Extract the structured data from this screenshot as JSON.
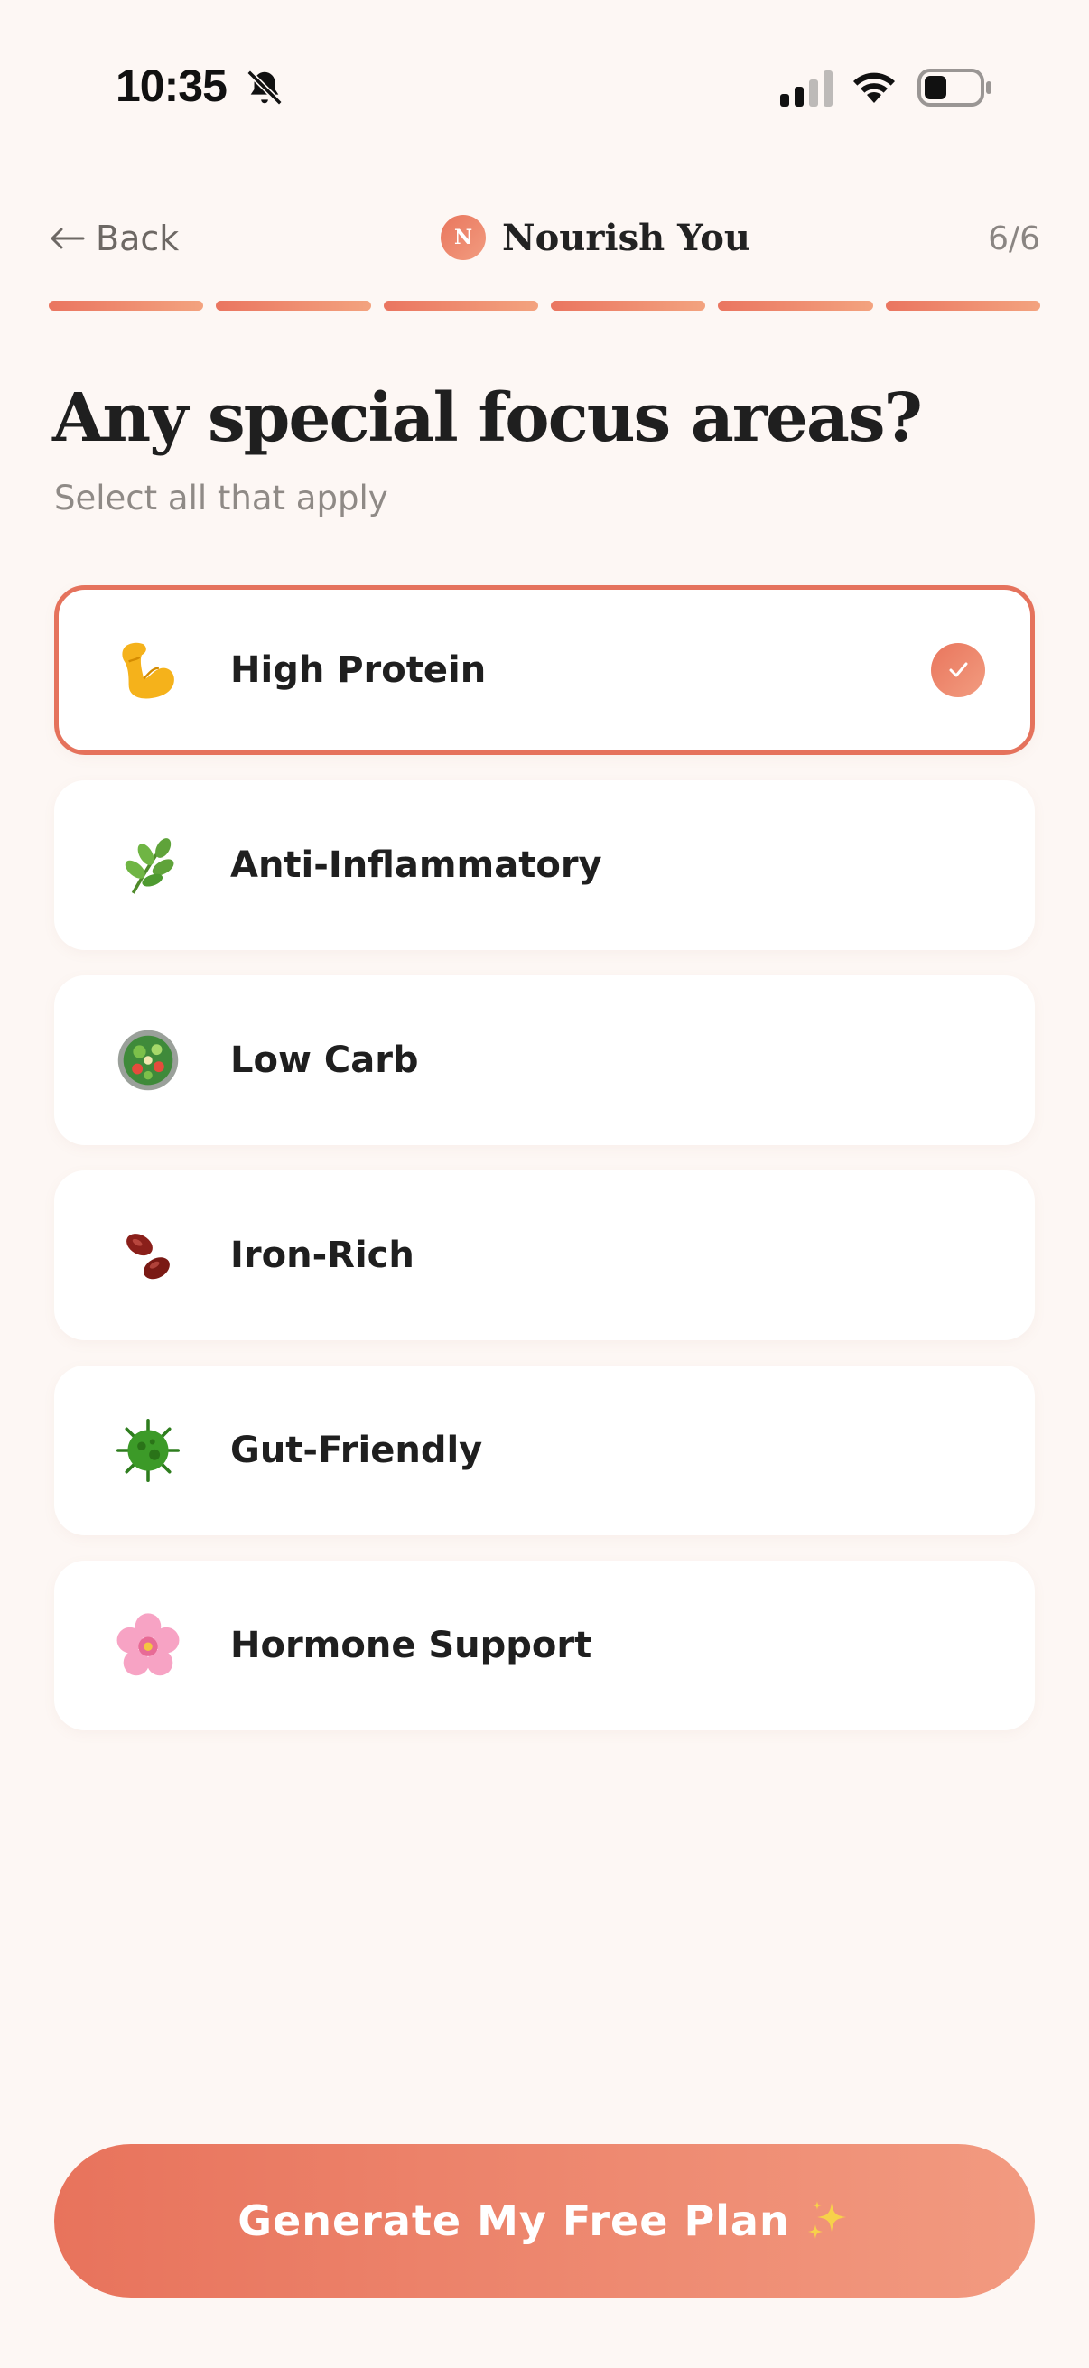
{
  "status_bar": {
    "time": "10:35"
  },
  "header": {
    "back_label": "Back",
    "brand_initial": "N",
    "brand_name": "Nourish You",
    "step": "6/6"
  },
  "progress": {
    "completed_steps": 6,
    "total_steps": 6
  },
  "title": "Any special focus areas?",
  "subtitle": "Select all that apply",
  "options": [
    {
      "label": "High Protein",
      "icon": "flexed-biceps-icon",
      "selected": true
    },
    {
      "label": "Anti-Inflammatory",
      "icon": "herb-icon",
      "selected": false
    },
    {
      "label": "Low Carb",
      "icon": "salad-bowl-icon",
      "selected": false
    },
    {
      "label": "Iron-Rich",
      "icon": "beans-icon",
      "selected": false
    },
    {
      "label": "Gut-Friendly",
      "icon": "microbe-icon",
      "selected": false
    },
    {
      "label": "Hormone Support",
      "icon": "cherry-blossom-icon",
      "selected": false
    }
  ],
  "cta_label": "Generate My Free Plan",
  "colors": {
    "accent": "#e5725c",
    "accent_light": "#f29c80",
    "background": "#fdf7f4",
    "card": "#ffffff"
  }
}
